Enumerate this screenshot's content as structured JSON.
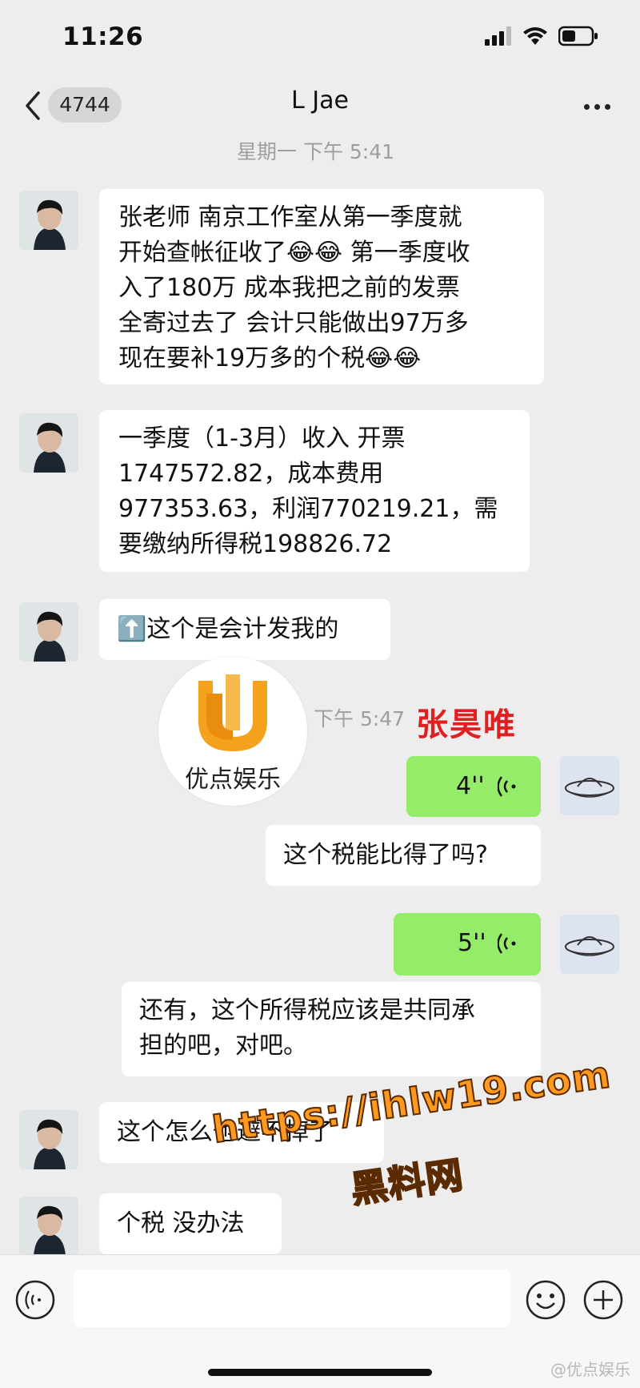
{
  "status": {
    "time": "11:26"
  },
  "nav": {
    "back_count": "4744",
    "title": "L Jae"
  },
  "timestamps": {
    "t1": "星期一 下午 5:41",
    "t2": "下午 5:47"
  },
  "messages": {
    "m1": {
      "lines": [
        "张老师 南京工作室从第一季度就",
        "开始查帐征收了😂😂 第一季度收",
        "入了180万 成本我把之前的发票",
        "全寄过去了 会计只能做出97万多",
        "现在要补19万多的个税😂😂"
      ]
    },
    "m2": {
      "lines": [
        "一季度（1-3月）收入 开票",
        "1747572.82，成本费用",
        "977353.63，利润770219.21，需",
        "要缴纳所得税198826.72"
      ]
    },
    "m3": {
      "text": "⬆️这个是会计发我的"
    },
    "m4": {
      "duration": "4''"
    },
    "m5": {
      "text": "这个税能比得了吗?"
    },
    "m6": {
      "duration": "5''"
    },
    "m7": {
      "lines": [
        "还有，这个所得税应该是共同承",
        "担的吧，对吧。"
      ]
    },
    "m8": {
      "text": "这个怎么也避不掉了"
    },
    "m9": {
      "text": "个税 没办法"
    }
  },
  "watermarks": {
    "logo_text": "优点娱乐",
    "name_tag": "张昊唯",
    "url": "https://ihlw19.com",
    "site": "黑料网",
    "footer": "@优点娱乐"
  },
  "colors": {
    "voice_bubble": "#95ec69",
    "name_tag": "#e02020",
    "watermark": "#ff9a1f",
    "logo_orange": "#f4a11d"
  },
  "icons": [
    "chevron-left-icon",
    "more-dots-icon",
    "voice-wave-icon",
    "voice-input-icon",
    "emoji-icon",
    "plus-icon",
    "signal-icon",
    "wifi-icon",
    "battery-icon"
  ]
}
